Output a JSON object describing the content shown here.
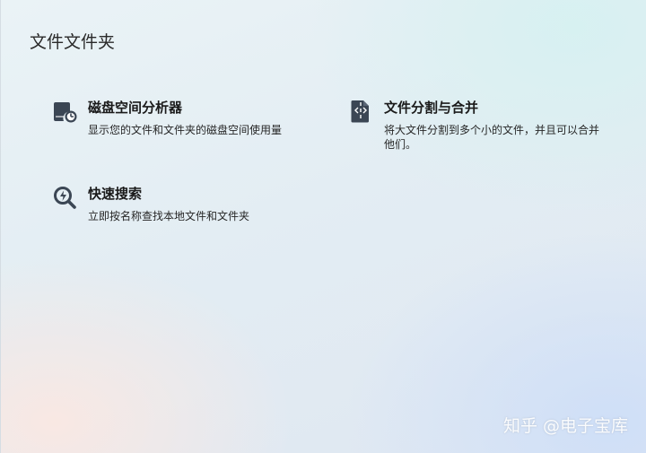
{
  "section": {
    "title": "文件文件夹"
  },
  "tools": {
    "disk_analyzer": {
      "icon": "disk-analyzer-icon",
      "title": "磁盘空间分析器",
      "description": "显示您的文件和文件夹的磁盘空间使用量"
    },
    "file_split": {
      "icon": "file-split-icon",
      "title": "文件分割与合并",
      "description": "将大文件分割到多个小的文件，并且可以合并他们。"
    },
    "quick_search": {
      "icon": "quick-search-icon",
      "title": "快速搜索",
      "description": "立即按名称查找本地文件和文件夹"
    }
  },
  "watermark": "知乎 @电子宝库",
  "colors": {
    "icon_dark": "#3b4654",
    "icon_light": "#ffffff"
  }
}
